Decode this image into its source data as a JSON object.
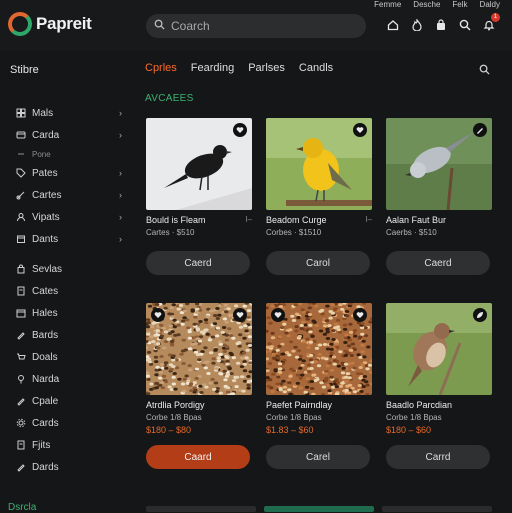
{
  "header": {
    "app_name": "Papreit",
    "top_links": [
      "Femme",
      "Desche",
      "Felk",
      "Daldy"
    ],
    "search_placeholder": "Coarch",
    "notification_count": "1",
    "icons": [
      "home-icon",
      "fire-icon",
      "bag-icon",
      "search-icon",
      "bell-icon"
    ]
  },
  "sidebar": {
    "title": "Stibre",
    "items": [
      {
        "label": "Mals",
        "icon": "grid-icon",
        "chevron": true
      },
      {
        "label": "Carda",
        "icon": "card-icon",
        "chevron": true
      },
      {
        "label": "Pone",
        "icon": "sub-icon",
        "chevron": false,
        "small": true
      },
      {
        "label": "Pates",
        "icon": "tag-icon",
        "chevron": true
      },
      {
        "label": "Cartes",
        "icon": "link-icon",
        "chevron": true
      },
      {
        "label": "Vipats",
        "icon": "user-icon",
        "chevron": true
      },
      {
        "label": "Dants",
        "icon": "box-icon",
        "chevron": true
      },
      {
        "label": "Sevlas",
        "icon": "bag-icon",
        "chevron": false
      },
      {
        "label": "Cates",
        "icon": "doc-icon",
        "chevron": false
      },
      {
        "label": "Hales",
        "icon": "calendar-icon",
        "chevron": false
      },
      {
        "label": "Bards",
        "icon": "pen-icon",
        "chevron": false
      },
      {
        "label": "Doals",
        "icon": "cart-icon",
        "chevron": false
      },
      {
        "label": "Narda",
        "icon": "pin-icon",
        "chevron": false
      },
      {
        "label": "Cpale",
        "icon": "pen-icon",
        "chevron": false
      },
      {
        "label": "Cards",
        "icon": "gear-icon",
        "chevron": false
      },
      {
        "label": "Fjits",
        "icon": "doc-icon",
        "chevron": false
      },
      {
        "label": "Dards",
        "icon": "pen-icon",
        "chevron": false
      }
    ],
    "bottom_label": "Dsrcla"
  },
  "tabs": [
    {
      "label": "Cprles",
      "active": true
    },
    {
      "label": "Fearding",
      "active": false
    },
    {
      "label": "Parlses",
      "active": false
    },
    {
      "label": "Candls",
      "active": false
    }
  ],
  "section_title": "AVCAEES",
  "products": [
    {
      "title": "Bould is Fleam",
      "meta": "Cartes · $510",
      "price": "",
      "button": "Caerd",
      "button_style": "dark",
      "image": "black-bird",
      "fav_icon": "heart-icon",
      "extra": "l–"
    },
    {
      "title": "Beadom Curge",
      "meta": "Corbes · $1510",
      "price": "",
      "button": "Carol",
      "button_style": "dark",
      "image": "yellow-bird",
      "fav_icon": "heart-icon",
      "extra": "l–"
    },
    {
      "title": "Aalan Faut Bur",
      "meta": "Caerbs · $510",
      "price": "",
      "button": "Caerd",
      "button_style": "dark",
      "image": "grey-bird",
      "fav_icon": "pen-icon",
      "extra": ""
    },
    {
      "title": "Atrdlia Pordigy",
      "meta": "Corbe 1/8 Bpas",
      "price": "$180 – $80",
      "button": "Caard",
      "button_style": "orange",
      "image": "seed-mix",
      "fav_icon": "heart-icon",
      "extra": ""
    },
    {
      "title": "Paefet Pairndlay",
      "meta": "Corbe 1/8 Bpas",
      "price": "$1.83 – $60",
      "button": "Carel",
      "button_style": "dark",
      "image": "seed-mix-2",
      "fav_icon": "heart-icon",
      "extra": ""
    },
    {
      "title": "Baadlo Parcdian",
      "meta": "Corbe 1/8 Bpas",
      "price": "$180 – $60",
      "button": "Carrd",
      "button_style": "dark",
      "image": "brown-bird",
      "fav_icon": "leaf-icon",
      "extra": ""
    }
  ],
  "colors": {
    "accent": "#ff6a2a",
    "green": "#3cb173",
    "bg": "#151617",
    "button": "#2f3032",
    "button_orange": "#b23d17"
  }
}
